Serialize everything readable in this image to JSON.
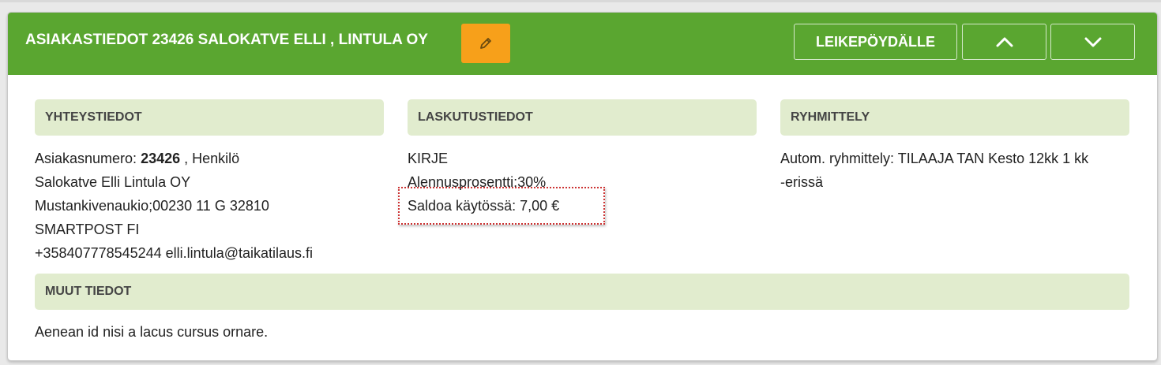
{
  "header": {
    "title": "ASIAKASTIEDOT 23426 SALOKATVE ELLI , LINTULA OY",
    "clipboard_label": "LEIKEPÖYDÄLLE",
    "icons": {
      "edit": "pencil-icon",
      "up": "chevron-up-icon",
      "down": "chevron-down-icon"
    },
    "colors": {
      "header_bg": "#5aa630",
      "edit_bg": "#f7a01a",
      "section_bg": "#e1ecce"
    }
  },
  "contact": {
    "heading": "YHTEYSTIEDOT",
    "customer_number_label": "Asiakasnumero: ",
    "customer_number": "23426",
    "customer_type": " , Henkilö",
    "name": "Salokatve Elli Lintula OY",
    "address": "Mustankivenaukio;00230 11 G 32810",
    "delivery": "SMARTPOST FI",
    "phone_email": "+358407778545244 elli.lintula@taikatilaus.fi"
  },
  "billing": {
    "heading": "LASKUTUSTIEDOT",
    "method": "KIRJE",
    "discount": "Alennusprosentti:30%",
    "balance": "Saldoa käytössä: 7,00 €"
  },
  "grouping": {
    "heading": "RYHMITTELY",
    "line1": "Autom. ryhmittely: TILAAJA TAN Kesto 12kk 1 kk",
    "line2": "-erissä"
  },
  "other": {
    "heading": "MUUT TIEDOT",
    "text": "Aenean id nisi a lacus cursus ornare."
  }
}
